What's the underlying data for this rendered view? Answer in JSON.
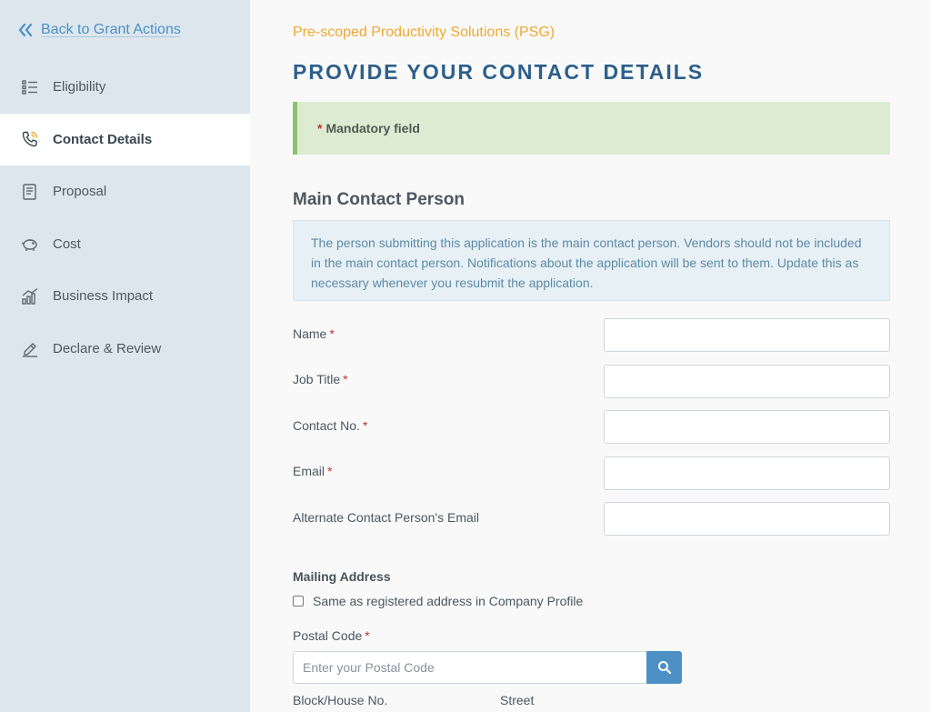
{
  "sidebar": {
    "back_label": "Back to Grant Actions",
    "items": [
      {
        "label": "Eligibility",
        "icon": "list-icon"
      },
      {
        "label": "Contact Details",
        "icon": "phone-icon",
        "active": true
      },
      {
        "label": "Proposal",
        "icon": "document-icon"
      },
      {
        "label": "Cost",
        "icon": "piggy-bank-icon"
      },
      {
        "label": "Business Impact",
        "icon": "bar-chart-icon"
      },
      {
        "label": "Declare & Review",
        "icon": "pen-icon"
      }
    ]
  },
  "header": {
    "program": "Pre-scoped Productivity Solutions (PSG)",
    "title": "PROVIDE YOUR CONTACT DETAILS"
  },
  "mandatory_note": {
    "star": "*",
    "text": "Mandatory field"
  },
  "main_contact": {
    "title": "Main Contact Person",
    "info": "The person submitting this application is the main contact person. Vendors should not be included in the main contact person. Notifications about the application will be sent to them. Update this as necessary whenever you resubmit the application.",
    "fields": [
      {
        "label": "Name",
        "required": "*",
        "value": ""
      },
      {
        "label": "Job Title",
        "required": "*",
        "value": ""
      },
      {
        "label": "Contact No.",
        "required": "*",
        "value": ""
      },
      {
        "label": "Email",
        "required": "*",
        "value": ""
      },
      {
        "label": "Alternate Contact Person's Email",
        "value": ""
      }
    ]
  },
  "mailing": {
    "title": "Mailing Address",
    "same_as_label": "Same as registered address in Company Profile",
    "same_as_checked": false,
    "postal_label": "Postal Code",
    "postal_required": "*",
    "postal_placeholder": "Enter your Postal Code",
    "block_label": "Block/House No.",
    "street_label": "Street"
  },
  "colors": {
    "accent": "#4d90c6",
    "program": "#f0a830",
    "title": "#2d5f8a",
    "mandatory_bg": "#dcebd2",
    "required": "#c0392b"
  }
}
